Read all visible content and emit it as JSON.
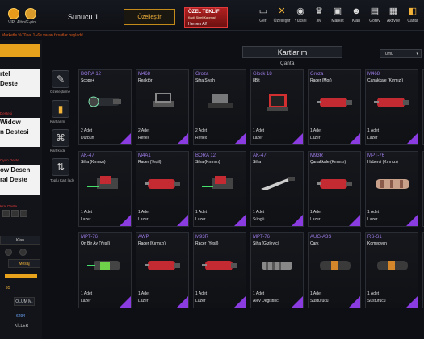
{
  "topbar": {
    "vip_label": "VIP",
    "epin_label": "Altın/E-pin",
    "server": "Sunucu 1",
    "customize_label": "Özelleştir",
    "offer": {
      "title": "ÖZEL TEKLİF!",
      "subtitle": "Kısıtlı Süreli Kaçırma!",
      "cta": "Hemen Al!"
    },
    "nav": [
      {
        "label": "Geri",
        "icon": "back-icon"
      },
      {
        "label": "Özelleştir",
        "icon": "customize-icon"
      },
      {
        "label": "Yüksel",
        "icon": "rank-icon"
      },
      {
        "label": "JM",
        "icon": "jm-icon"
      },
      {
        "label": "Market",
        "icon": "market-icon"
      },
      {
        "label": "Klan",
        "icon": "clan-icon"
      },
      {
        "label": "Görev",
        "icon": "mission-icon"
      },
      {
        "label": "Aktivite",
        "icon": "activity-icon"
      },
      {
        "label": "Çanta",
        "icon": "bag-icon"
      }
    ]
  },
  "promo_text": "Marketle %70 ve 1+6e varan fırsatlar başladı!",
  "side": {
    "card1_line1": "rtel",
    "card1_line2": "Deste",
    "tag2": "Destesi",
    "card2_line1": "Widow",
    "card2_line2": "n Destesi",
    "tag3": "Oyun Deste",
    "card3_line1": "ow Desen",
    "card3_line2": "ral Deste",
    "tag4": "Kral Deste",
    "tab_clan": "Klan",
    "tab_message": "Mesaj",
    "level": "95",
    "death_label": "ÖLÜM M.",
    "value": "6294",
    "footer": "KİLLER"
  },
  "tools": [
    {
      "label": "Özelleştirme",
      "icon": "customize-tool-icon"
    },
    {
      "label": "Kartlarım",
      "icon": "cards-icon"
    },
    {
      "label": "Kart kode",
      "icon": "card-code-icon"
    },
    {
      "label": "Toplu Kart İade",
      "icon": "bulk-return-icon"
    }
  ],
  "main": {
    "title": "Kartlarım",
    "subtitle": "Çanta",
    "filter": "Tümü"
  },
  "cards": [
    {
      "brand": "BORA 12",
      "sub": "Scope+",
      "qty": "2 Adet",
      "type": "Dürbün",
      "art": "scope"
    },
    {
      "brand": "M468",
      "sub": "Reaktör",
      "qty": "2 Adet",
      "type": "Reflex",
      "art": "reflex"
    },
    {
      "brand": "Groza",
      "sub": "Siha Siyah",
      "qty": "2 Adet",
      "type": "Reflex",
      "art": "reflex2"
    },
    {
      "brand": "Glock 18",
      "sub": "8Bit",
      "qty": "1 Adet",
      "type": "Lazer",
      "art": "pixel"
    },
    {
      "brand": "Groza",
      "sub": "Racer (Mor)",
      "qty": "1 Adet",
      "type": "Lazer",
      "art": "laser-red"
    },
    {
      "brand": "M468",
      "sub": "Çanakkale (Kırmızı)",
      "qty": "1 Adet",
      "type": "Lazer",
      "art": "laser-red"
    },
    {
      "brand": "AK-47",
      "sub": "Siha (Kırmızı)",
      "qty": "1 Adet",
      "type": "Lazer",
      "art": "laser-green"
    },
    {
      "brand": "M4A1",
      "sub": "Racer (Yeşil)",
      "qty": "1 Adet",
      "type": "Lazer",
      "art": "laser-red"
    },
    {
      "brand": "BORA 12",
      "sub": "Siha (Kırmızı)",
      "qty": "1 Adet",
      "type": "Lazer",
      "art": "laser-green"
    },
    {
      "brand": "AK-47",
      "sub": "Siha",
      "qty": "1 Adet",
      "type": "Süngü",
      "art": "blade"
    },
    {
      "brand": "M93R",
      "sub": "Çanakkale (Kırmızı)",
      "qty": "1 Adet",
      "type": "Lazer",
      "art": "laser-red"
    },
    {
      "brand": "MPT-76",
      "sub": "Haberci (Kırmızı)",
      "qty": "1 Adet",
      "type": "Lazer",
      "art": "laser-pattern"
    },
    {
      "brand": "MPT-76",
      "sub": "On Bir Ay (Yeşil)",
      "qty": "1 Adet",
      "type": "Lazer",
      "art": "laser-green2"
    },
    {
      "brand": "AWP",
      "sub": "Racer (Kırmızı)",
      "qty": "1 Adet",
      "type": "Lazer",
      "art": "laser-red"
    },
    {
      "brand": "M93R",
      "sub": "Racer (Yeşil)",
      "qty": "1 Adet",
      "type": "Lazer",
      "art": "laser-red"
    },
    {
      "brand": "MPT-76",
      "sub": "Siha (Gizleyici)",
      "qty": "1 Adet",
      "type": "Alev Değiştirici",
      "art": "flash"
    },
    {
      "brand": "AUG-A3S",
      "sub": "Çark",
      "qty": "1 Adet",
      "type": "Susturucu",
      "art": "silencer"
    },
    {
      "brand": "RS-S1",
      "sub": "Komedyen",
      "qty": "1 Adet",
      "type": "Susturucu",
      "art": "silencer"
    }
  ],
  "colors": {
    "accent": "#e8a21c",
    "brand": "#9f7ce8",
    "rarity": "#8a3ce0",
    "offer": "#b22020"
  }
}
